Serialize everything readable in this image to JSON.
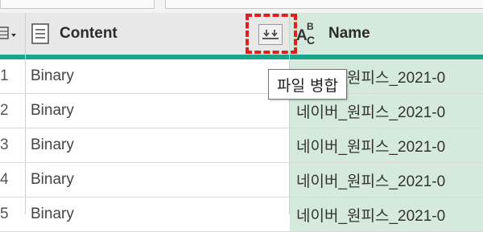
{
  "header": {
    "content_label": "Content",
    "name_label": "Name",
    "name_type_glyph_top": "B",
    "name_type_glyph_a": "A",
    "name_type_glyph_c": "C"
  },
  "tooltip": {
    "text": "파일 병합"
  },
  "rows": [
    {
      "num": "1",
      "content": "Binary",
      "name": "네이버_원피스_2021-0"
    },
    {
      "num": "2",
      "content": "Binary",
      "name": "네이버_원피스_2021-0"
    },
    {
      "num": "3",
      "content": "Binary",
      "name": "네이버_원피스_2021-0"
    },
    {
      "num": "4",
      "content": "Binary",
      "name": "네이버_원피스_2021-0"
    },
    {
      "num": "5",
      "content": "Binary",
      "name": "네이버_원피스_2021-0"
    }
  ],
  "colors": {
    "header_bg": "#e8e8e8",
    "name_column_bg": "#d5eadc",
    "accent_teal": "#18a58b",
    "highlight_red": "#e0201c"
  },
  "icons": {
    "table_menu": "table-icon",
    "content_type": "list-document-icon",
    "expand_binary": "combine-files-icon"
  }
}
